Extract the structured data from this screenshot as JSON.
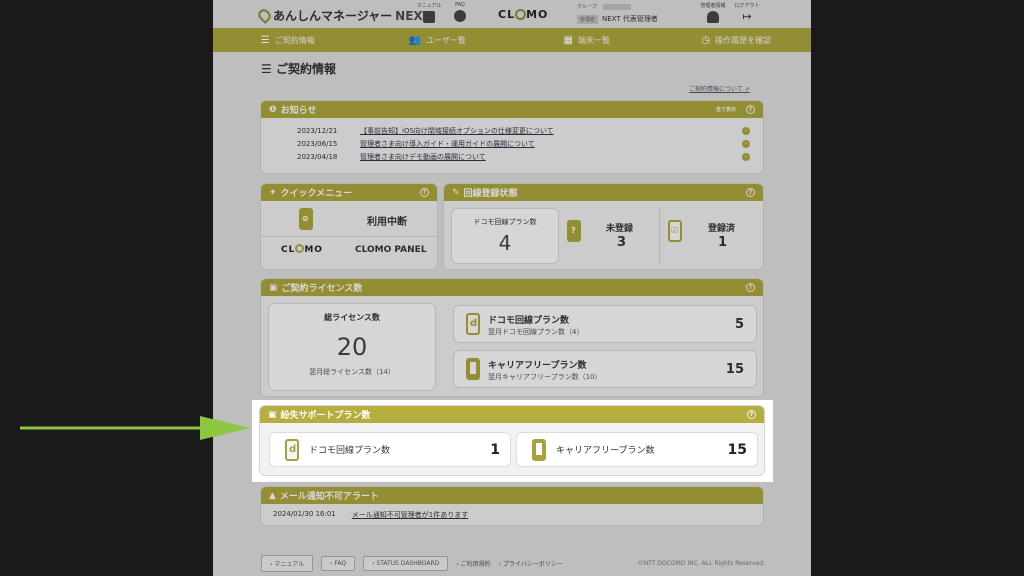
{
  "header": {
    "brand": "あんしんマネージャー",
    "brand_suffix": "NEXT",
    "manual_label": "マニュアル",
    "faq_label": "FAQ",
    "clomo_logo": "CLOMO",
    "group_label": "グループ",
    "admin_tag": "管理者",
    "admin_name": "NEXT 代表管理者",
    "manage_label": "管理者情報",
    "logout_label": "ログアウト"
  },
  "nav": [
    {
      "label": "ご契約情報",
      "icon": "☰"
    },
    {
      "label": "ユーザー覧",
      "icon": "👥"
    },
    {
      "label": "端末一覧",
      "icon": "▦"
    },
    {
      "label": "操作履歴を確認",
      "icon": "◷"
    }
  ],
  "page_title": "ご契約情報",
  "about_link": "ご契約情報について",
  "news": {
    "title": "お知らせ",
    "more": "全て表示",
    "items": [
      {
        "date": "2023/12/21",
        "title": "【事前告知】iOS向け閉域接続オプションの仕様変更について"
      },
      {
        "date": "2023/06/15",
        "title": "管理者さま向け導入ガイド・運用ガイドの展開について"
      },
      {
        "date": "2023/04/18",
        "title": "管理者さま向けデモ動画の展開について"
      }
    ]
  },
  "quick_menu": {
    "title": "クイックメニュー",
    "status": "利用中断",
    "clomo_logo": "CLOMO",
    "clomo_panel": "CLOMO PANEL"
  },
  "line_status": {
    "title": "回線登録状態",
    "plan_label": "ドコモ回線プラン数",
    "plan_value": "4",
    "unregistered_label": "未登録",
    "unregistered_value": "3",
    "registered_label": "登録済",
    "registered_value": "1"
  },
  "license": {
    "title": "ご契約ライセンス数",
    "total_label": "総ライセンス数",
    "total_value": "20",
    "total_next": "翌月総ライセンス数（14）",
    "docomo_label": "ドコモ回線プラン数",
    "docomo_next": "翌月ドコモ回線プラン数（4）",
    "docomo_value": "5",
    "carrier_label": "キャリアフリープラン数",
    "carrier_next": "翌月キャリアフリープラン数（10）",
    "carrier_value": "15"
  },
  "lost_support": {
    "title": "紛失サポートプラン数",
    "docomo_label": "ドコモ回線プラン数",
    "docomo_value": "1",
    "carrier_label": "キャリアフリープラン数",
    "carrier_value": "15"
  },
  "mail_alert": {
    "title": "メール通知不可アラート",
    "date": "2024/01/30 16:01",
    "message": "メール通知不可管理者が1件あります"
  },
  "footer": {
    "manual": "› マニュアル",
    "faq": "› FAQ",
    "status": "› STATUS DASHBOARD",
    "terms": "› ご利用規約",
    "privacy": "› プライバシーポリシー",
    "copyright": "©NTT DOCOMO INC. ALL Rights Reserved."
  },
  "colors": {
    "accent": "#a8a23c",
    "arrow": "#8dc63f"
  }
}
